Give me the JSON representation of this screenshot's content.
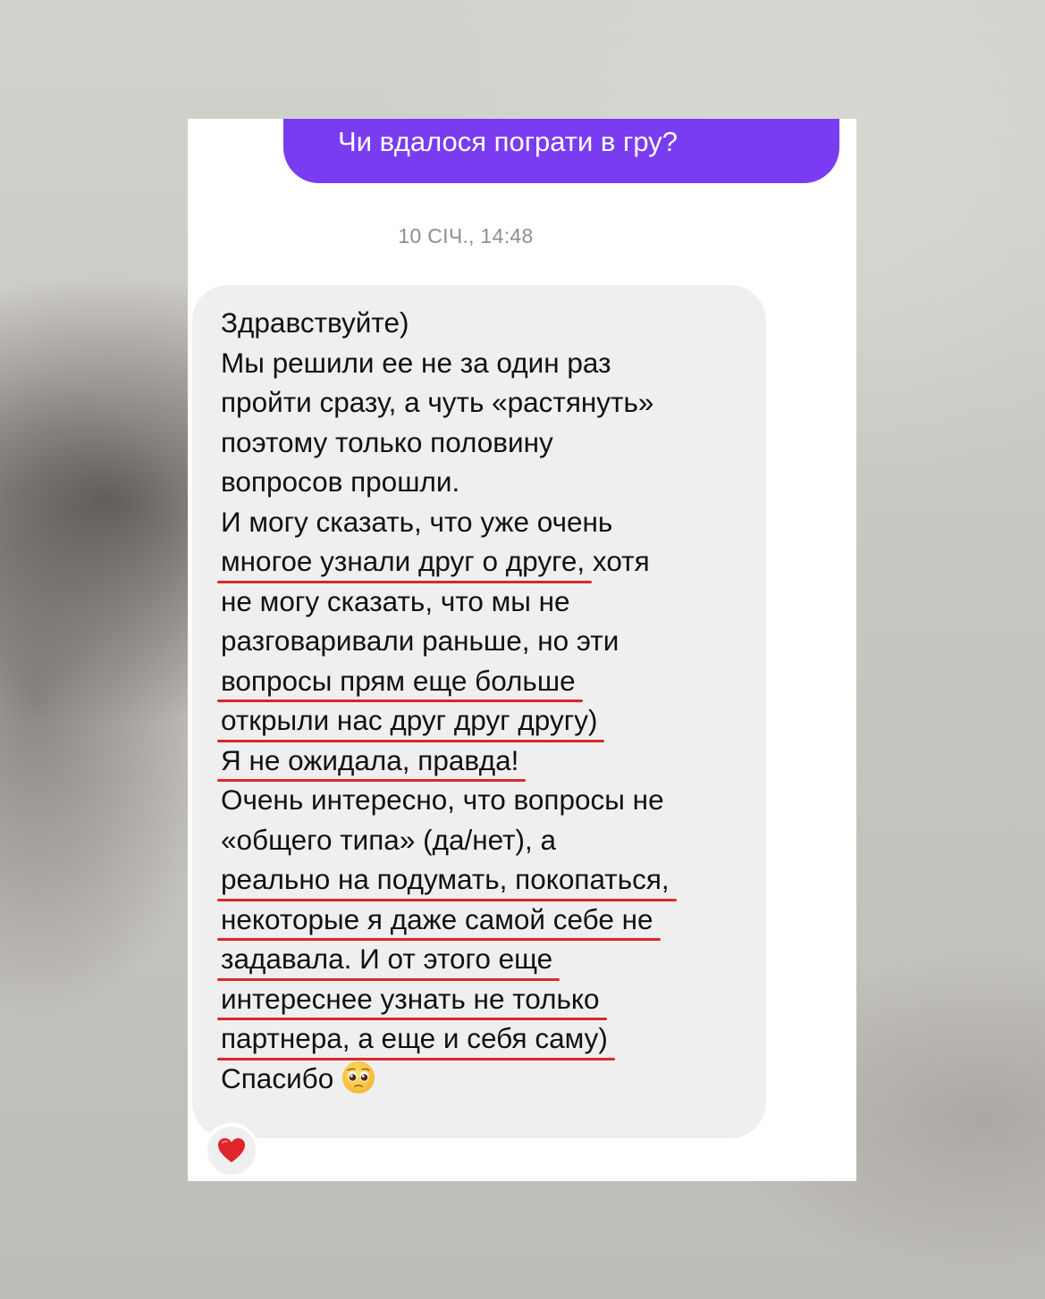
{
  "outgoing_message": {
    "text": "Чи вдалося пограти в гру?",
    "color": "#7a3cf0"
  },
  "timestamp": "10 СІЧ., 14:48",
  "incoming_message": {
    "lines": [
      {
        "text": "Здравствуйте)",
        "underlined": false
      },
      {
        "text": "Мы решили ее не за один раз",
        "underlined": false
      },
      {
        "text": "пройти сразу, а чуть «растянуть»",
        "underlined": false
      },
      {
        "text": "поэтому только половину",
        "underlined": false
      },
      {
        "text": "вопросов прошли.",
        "underlined": false
      },
      {
        "text": "И могу сказать, что уже очень",
        "underlined": false
      },
      {
        "text": "многое узнали друг о друге,",
        "underlined": true,
        "tail": " хотя"
      },
      {
        "text": "не могу сказать, что мы не",
        "underlined": false
      },
      {
        "text": "разговаривали раньше, но эти",
        "underlined": false
      },
      {
        "text": "вопросы прям еще больше",
        "underlined": true
      },
      {
        "text": "открыли нас друг друг другу)",
        "underlined": true
      },
      {
        "text": "Я не ожидала, правда!",
        "underlined": true
      },
      {
        "text": "Очень интересно, что вопросы не",
        "underlined": false
      },
      {
        "text": "«общего типа» (да/нет), а",
        "underlined": false
      },
      {
        "text": "реально на подумать, покопаться,",
        "underlined": true
      },
      {
        "text": "некоторые я даже самой себе не",
        "underlined": true
      },
      {
        "text": "задавала. И от этого еще",
        "underlined": true
      },
      {
        "text": "интереснее узнать не только",
        "underlined": true
      },
      {
        "text": "партнера, а еще и себя саму)",
        "underlined": true
      },
      {
        "text": "Спасибо",
        "underlined": false,
        "emoji": "pleading-face-emoji"
      }
    ],
    "underline_color": "#d8282c"
  },
  "reaction": {
    "emoji": "red-heart-emoji",
    "color": "#e0242c"
  }
}
